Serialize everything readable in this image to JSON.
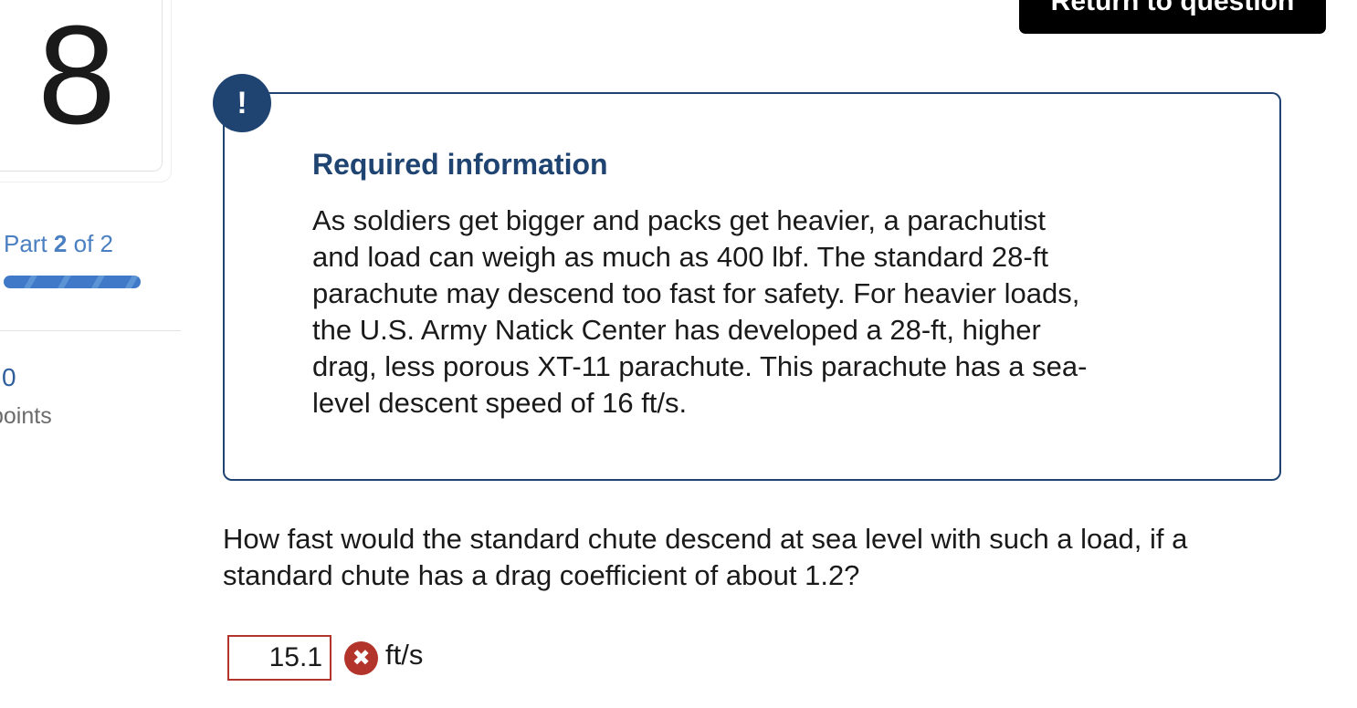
{
  "question_number": "8",
  "part": {
    "prefix": "Part",
    "current": "2",
    "separator": "of 2"
  },
  "progress_fraction": 1.0,
  "points": {
    "value": "0",
    "label": "points"
  },
  "return_button": {
    "label": "Return to question"
  },
  "info": {
    "badge": "!",
    "title": "Required information",
    "body_lines": [
      "As soldiers get bigger and packs get heavier, a parachutist",
      "and load can weigh as much as 400 lbf. The standard 28-ft",
      "parachute may descend too fast for safety. For heavier loads,",
      "the U.S. Army Natick Center has developed a 28-ft, higher",
      "drag, less porous XT-11 parachute. This parachute has a sea-",
      "level descent speed of 16 ft/s."
    ]
  },
  "question": {
    "lines": [
      "How fast would the standard chute descend at sea level with such a load, if a",
      "standard chute has a drag coefficient of about 1.2?"
    ]
  },
  "answer": {
    "value": "15.1",
    "status_icon": "incorrect-icon",
    "unit": "ft/s"
  },
  "colors": {
    "navy": "#1f4472",
    "link_blue": "#4a7fc1",
    "error_red": "#b3342b"
  }
}
